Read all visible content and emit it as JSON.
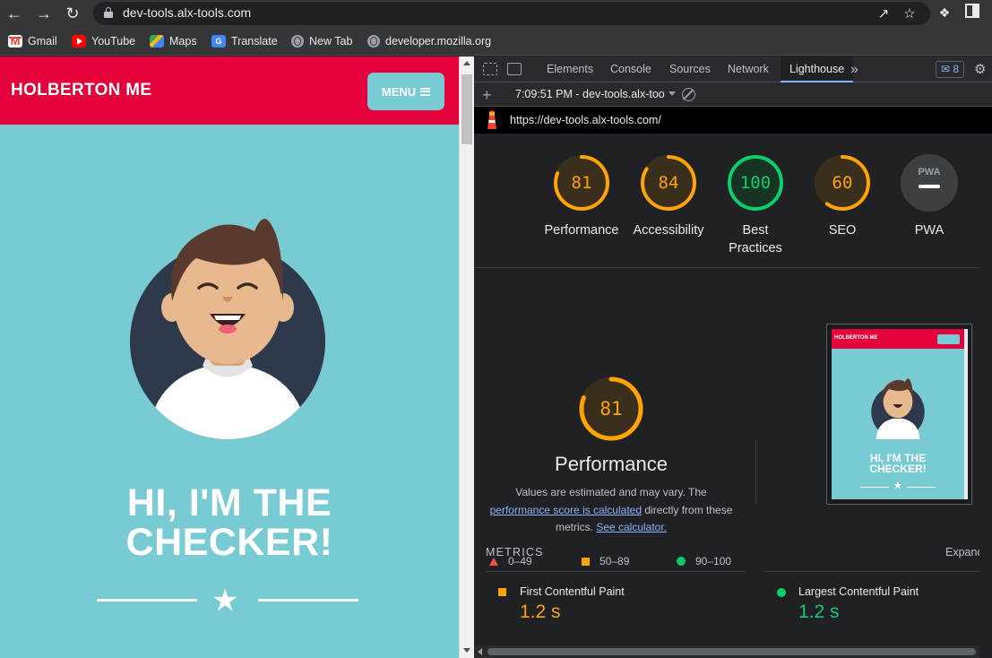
{
  "browser": {
    "url": "dev-tools.alx-tools.com",
    "bookmarks": [
      "Gmail",
      "YouTube",
      "Maps",
      "Translate",
      "New Tab",
      "developer.mozilla.org"
    ]
  },
  "site": {
    "logo": "HOLBERTON ME",
    "menu_label": "MENU",
    "hero_title_line1": "HI, I'M THE",
    "hero_title_line2": "CHECKER!",
    "colors": {
      "header": "#e4003b",
      "background": "#78cbd2"
    }
  },
  "devtools": {
    "tabs": [
      "Elements",
      "Console",
      "Sources",
      "Network",
      "Lighthouse"
    ],
    "active_tab": "Lighthouse",
    "more_tabs_icon": "chevron-double-right-icon",
    "issues_count": "8",
    "report_label": "7:09:51 PM - dev-tools.alx-too",
    "report_url": "https://dev-tools.alx-tools.com/"
  },
  "lighthouse": {
    "categories": [
      {
        "label": "Performance",
        "score": "81",
        "fraction": 0.81,
        "color": "#ffa400"
      },
      {
        "label": "Accessibility",
        "score": "84",
        "fraction": 0.84,
        "color": "#ffa400"
      },
      {
        "label": "Best Practices",
        "label_line1": "Best",
        "label_line2": "Practices",
        "score": "100",
        "fraction": 1.0,
        "color": "#0cce6b"
      },
      {
        "label": "SEO",
        "score": "60",
        "fraction": 0.6,
        "color": "#ffa400"
      },
      {
        "label": "PWA",
        "badge_text": "PWA",
        "color": "#9aa0a6"
      }
    ],
    "performance": {
      "score": "81",
      "fraction": 0.81,
      "title": "Performance",
      "desc_part1": "Values are estimated and may vary. The",
      "desc_link1": "performance score is calculated",
      "desc_part2": "directly from these",
      "desc_part3": "metrics.",
      "desc_link2": "See calculator."
    },
    "legend": [
      {
        "range": "0–49",
        "shape": "triangle",
        "color": "#ff4e42"
      },
      {
        "range": "50–89",
        "shape": "square",
        "color": "#ffa400"
      },
      {
        "range": "90–100",
        "shape": "circle",
        "color": "#0cce6b"
      }
    ],
    "screenshot": {
      "logo": "HOLBERTON ME",
      "title_line1": "HI, I'M THE",
      "title_line2": "CHECKER!"
    },
    "metrics_heading": "METRICS",
    "expand_label": "Expand view",
    "metrics": [
      {
        "name": "First Contentful Paint",
        "value": "1.2 s",
        "color": "#ffa400"
      },
      {
        "name": "Largest Contentful Paint",
        "value": "1.2 s",
        "color": "#0cce6b"
      }
    ]
  }
}
